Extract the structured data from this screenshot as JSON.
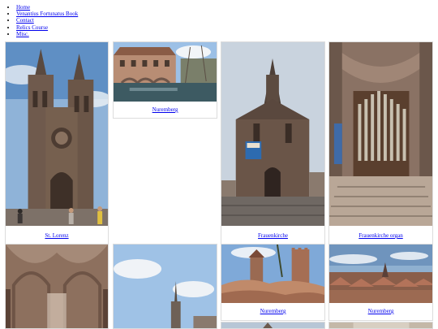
{
  "nav": {
    "items": [
      {
        "label": "Home"
      },
      {
        "label": "Venantius Fortunatus Book"
      },
      {
        "label": "Contact"
      },
      {
        "label": "Relics Course"
      },
      {
        "label": "Misc."
      }
    ]
  },
  "gallery": {
    "cards": [
      {
        "caption": "St. Lorenz",
        "photo": "st-lorenz-church-facade"
      },
      {
        "caption": "Nuremberg",
        "photo": "river-with-old-hospital-building"
      },
      {
        "caption": "Frauenkirche",
        "photo": "frauenkirche-gothic-facade"
      },
      {
        "caption": "Frauenkirche organ",
        "photo": "frauenkirche-interior-organ"
      },
      {
        "caption": "",
        "photo": "gothic-church-vaulted-interior"
      },
      {
        "caption": "",
        "photo": "fountain-spire-against-sky"
      },
      {
        "caption": "Nuremberg",
        "photo": "castle-tower-and-walls"
      },
      {
        "caption": "Nuremberg",
        "photo": "city-rooftops-panorama"
      }
    ]
  }
}
